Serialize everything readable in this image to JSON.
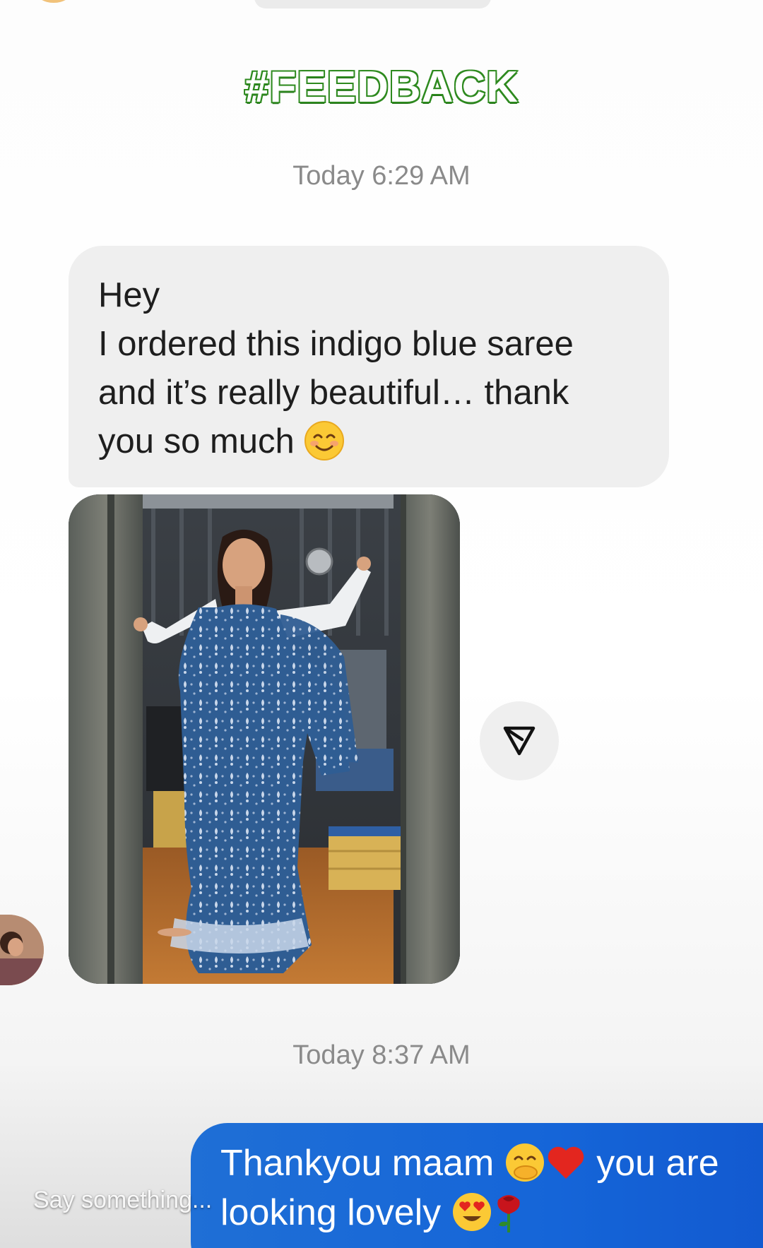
{
  "header": {
    "hashtag": "#FEEDBACK"
  },
  "timestamps": {
    "first": "Today 6:29 AM",
    "second": "Today 8:37 AM"
  },
  "incoming_message": {
    "lines": [
      "Hey",
      "I ordered this indigo blue saree",
      "and it’s really beautiful… thank",
      "you so much"
    ],
    "emoji": "smiling-face-icon"
  },
  "shared_photo": {
    "subject": "woman-in-indigo-saree-photo"
  },
  "share_button": {
    "icon": "send-icon"
  },
  "outgoing_message": {
    "line1_part1": "Thankyou maam",
    "line1_part2": "you are",
    "line2": "looking lovely",
    "emojis": [
      "hand-over-mouth-icon",
      "red-heart-icon",
      "heart-eyes-icon",
      "rose-icon"
    ]
  },
  "reply_input": {
    "placeholder": "Say something..."
  },
  "colors": {
    "hashtag_fill": "#ffffff",
    "hashtag_stroke": "#2e8a1f",
    "incoming_bubble": "#efefef",
    "outgoing_bubble": "#1565d8",
    "timestamp": "#8a8a8a"
  }
}
